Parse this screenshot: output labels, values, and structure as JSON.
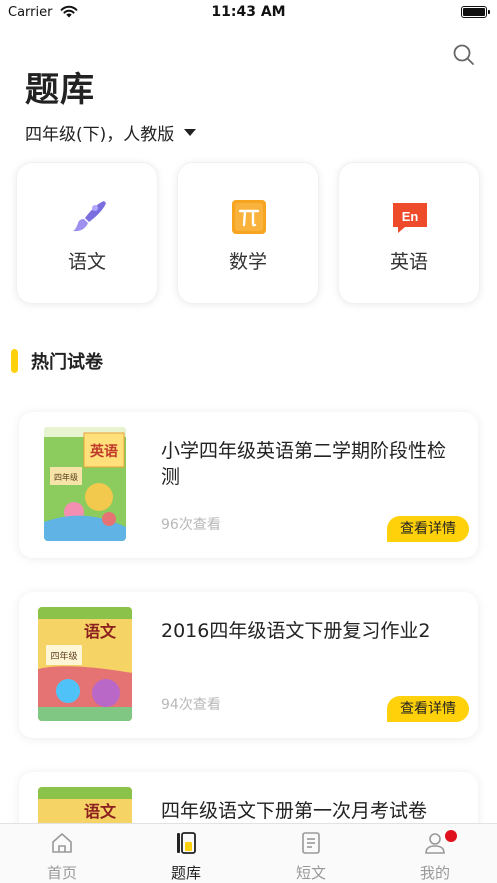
{
  "status_bar": {
    "carrier": "Carrier",
    "time": "11:43 AM"
  },
  "header": {
    "title": "题库",
    "grade_label": "四年级(下)，人教版"
  },
  "subjects": [
    {
      "label": "语文",
      "icon": "brush-icon",
      "color": "#7B6FE0"
    },
    {
      "label": "数学",
      "icon": "pi-icon",
      "color": "#F7A41E"
    },
    {
      "label": "英语",
      "icon": "en-icon",
      "color": "#EE4B2B"
    }
  ],
  "section": {
    "title": "热门试卷",
    "accent_color": "#FFD10A"
  },
  "papers": [
    {
      "title": "小学四年级英语第二学期阶段性检测",
      "views": "96次查看",
      "button": "查看详情",
      "cover_title": "英语",
      "cover_grade": "四年级"
    },
    {
      "title": "2016四年级语文下册复习作业2",
      "views": "94次查看",
      "button": "查看详情",
      "cover_title": "语文",
      "cover_grade": "四年级"
    },
    {
      "title": "四年级语文下册第一次月考试卷",
      "views": "",
      "button": "",
      "cover_title": "语文",
      "cover_grade": ""
    }
  ],
  "tabs": [
    {
      "label": "首页",
      "icon": "home-icon",
      "active": false
    },
    {
      "label": "题库",
      "icon": "question-bank-icon",
      "active": true
    },
    {
      "label": "短文",
      "icon": "document-icon",
      "active": false
    },
    {
      "label": "我的",
      "icon": "profile-icon",
      "active": false,
      "badge": true
    }
  ],
  "colors": {
    "accent": "#FFD10A",
    "badge": "#E0101E",
    "inactive_tab": "#999999"
  }
}
